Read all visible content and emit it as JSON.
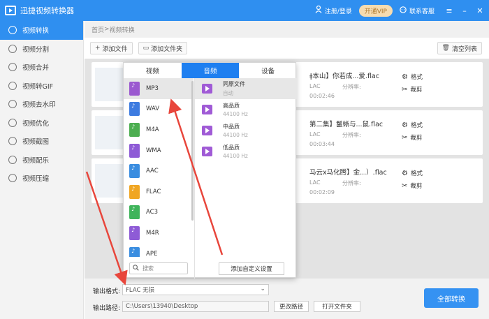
{
  "app": {
    "title": "迅捷视频转换器",
    "login": "注册/登录",
    "vip": "开通VIP",
    "support": "联系客服"
  },
  "sidebar": {
    "items": [
      {
        "label": "视频转换",
        "active": true
      },
      {
        "label": "视频分割"
      },
      {
        "label": "视频合并"
      },
      {
        "label": "视频转GIF"
      },
      {
        "label": "视频去水印"
      },
      {
        "label": "视频优化"
      },
      {
        "label": "视频截图"
      },
      {
        "label": "视频配乐"
      },
      {
        "label": "视频压缩"
      }
    ]
  },
  "breadcrumb": {
    "home": "首页",
    "sep": " > ",
    "current": "视频转换"
  },
  "toolbar": {
    "add_file": "添加文件",
    "add_folder": "添加文件夹",
    "clear": "清空列表"
  },
  "files": [
    {
      "name": "ǂ本山】你若成...爱.flac",
      "meta": "LAC",
      "meta2": "分辨率:",
      "duration": "00:02:46",
      "action1": "格式",
      "action2": "裁剪"
    },
    {
      "name": "第二集】鬣蜥与...鼠.flac",
      "meta": "LAC",
      "meta2": "分辨率:",
      "duration": "00:03:44",
      "action1": "格式",
      "action2": "裁剪"
    },
    {
      "name": "马云x马化腾】金...）.flac",
      "meta": "LAC",
      "meta2": "分辨率:",
      "duration": "00:02:09",
      "action1": "格式",
      "action2": "裁剪"
    }
  ],
  "popup": {
    "tabs": [
      "视频",
      "音频",
      "设备"
    ],
    "active_tab": "音频",
    "formats": [
      {
        "label": "MP3",
        "color": "#9b59d0"
      },
      {
        "label": "WAV",
        "color": "#3d7be0"
      },
      {
        "label": "M4A",
        "color": "#4cae50"
      },
      {
        "label": "WMA",
        "color": "#8e5bd6"
      },
      {
        "label": "AAC",
        "color": "#3a8de0"
      },
      {
        "label": "FLAC",
        "color": "#f0a623"
      },
      {
        "label": "AC3",
        "color": "#3fb45a"
      },
      {
        "label": "M4R",
        "color": "#8e5bd6"
      },
      {
        "label": "APE",
        "color": "#3a8de0"
      }
    ],
    "selected_format": "MP3",
    "qualities": [
      {
        "name": "同原文件",
        "sub": "自动"
      },
      {
        "name": "高品质",
        "sub": "44100 Hz"
      },
      {
        "name": "中品质",
        "sub": "44100 Hz"
      },
      {
        "name": "低品质",
        "sub": "44100 Hz"
      }
    ],
    "search_placeholder": "搜索",
    "custom_button": "添加自定义设置"
  },
  "bottom": {
    "format_label": "输出格式:",
    "format_value": "FLAC  无损",
    "path_label": "输出路径:",
    "path_value": "C:\\Users\\13940\\Desktop",
    "change_path": "更改路径",
    "open_folder": "打开文件夹",
    "convert_all": "全部转换"
  },
  "colors": {
    "accent": "#2f8ff0",
    "popup_tab_active": "#1e7ff0",
    "arrow": "#e8463c",
    "convert": "#3592f2"
  }
}
